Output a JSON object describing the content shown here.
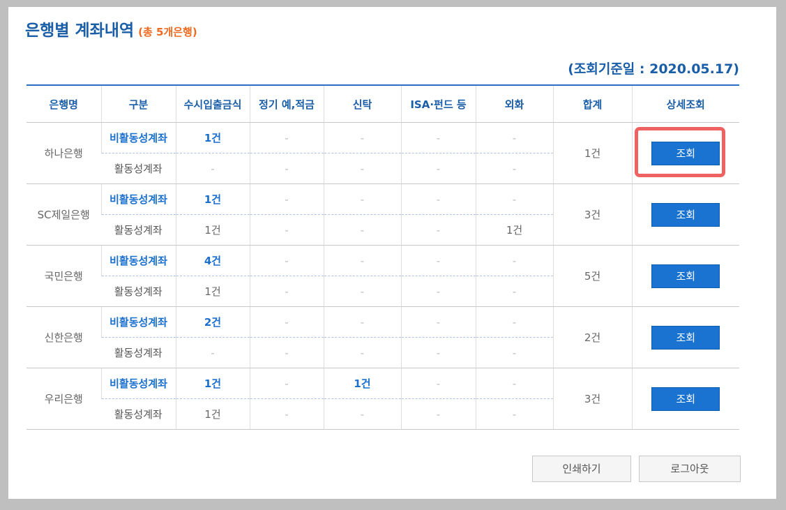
{
  "header": {
    "title": "은행별 계좌내역",
    "subtitle": "(총 5개은행)",
    "ref_date": "(조회기준일 : 2020.05.17)"
  },
  "table": {
    "columns": [
      "은행명",
      "구분",
      "수시입출금식",
      "정기 예,적금",
      "신탁",
      "ISA·펀드 등",
      "외화",
      "합계",
      "상세조회"
    ],
    "banks": [
      {
        "name": "하나은행",
        "total": "1건",
        "button": "조회",
        "inactive": {
          "label": "비활동성계좌",
          "values": [
            "1건",
            "-",
            "-",
            "-",
            "-"
          ]
        },
        "active": {
          "label": "활동성계좌",
          "values": [
            "-",
            "-",
            "-",
            "-",
            "-"
          ]
        }
      },
      {
        "name": "SC제일은행",
        "total": "3건",
        "button": "조회",
        "inactive": {
          "label": "비활동성계좌",
          "values": [
            "1건",
            "-",
            "-",
            "-",
            "-"
          ]
        },
        "active": {
          "label": "활동성계좌",
          "values": [
            "1건",
            "-",
            "-",
            "-",
            "1건"
          ]
        }
      },
      {
        "name": "국민은행",
        "total": "5건",
        "button": "조회",
        "inactive": {
          "label": "비활동성계좌",
          "values": [
            "4건",
            "-",
            "-",
            "-",
            "-"
          ]
        },
        "active": {
          "label": "활동성계좌",
          "values": [
            "1건",
            "-",
            "-",
            "-",
            "-"
          ]
        }
      },
      {
        "name": "신한은행",
        "total": "2건",
        "button": "조회",
        "inactive": {
          "label": "비활동성계좌",
          "values": [
            "2건",
            "-",
            "-",
            "-",
            "-"
          ]
        },
        "active": {
          "label": "활동성계좌",
          "values": [
            "-",
            "-",
            "-",
            "-",
            "-"
          ]
        }
      },
      {
        "name": "우리은행",
        "total": "3건",
        "button": "조회",
        "inactive": {
          "label": "비활동성계좌",
          "values": [
            "1건",
            "-",
            "1건",
            "-",
            "-"
          ]
        },
        "active": {
          "label": "활동성계좌",
          "values": [
            "1건",
            "-",
            "-",
            "-",
            "-"
          ]
        }
      }
    ]
  },
  "footer": {
    "print_label": "인쇄하기",
    "logout_label": "로그아웃"
  },
  "colors": {
    "title": "#1a5ea8",
    "accent_orange": "#ee6a1f",
    "button_blue": "#1a72d1",
    "highlight_red": "#ee6262"
  }
}
